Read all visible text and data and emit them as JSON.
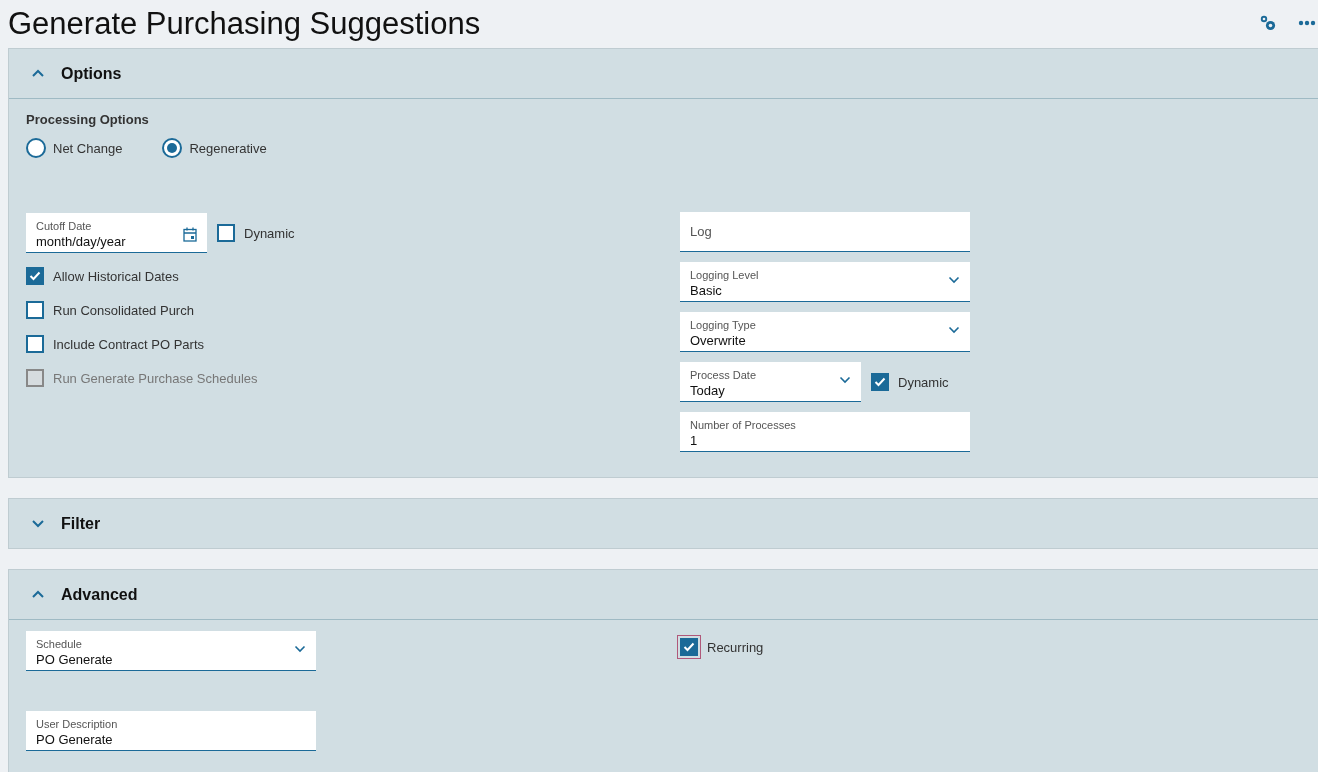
{
  "title": "Generate Purchasing Suggestions",
  "options": {
    "title": "Options",
    "expanded": true,
    "processing": {
      "label": "Processing Options",
      "radios": [
        {
          "label": "Net Change",
          "selected": false
        },
        {
          "label": "Regenerative",
          "selected": true
        }
      ]
    },
    "cutoff_date": {
      "label": "Cutoff Date",
      "value": "month/day/year"
    },
    "cutoff_dynamic": {
      "label": "Dynamic",
      "checked": false
    },
    "checkboxes": [
      {
        "label": "Allow Historical Dates",
        "checked": true,
        "disabled": false
      },
      {
        "label": "Run Consolidated Purch",
        "checked": false,
        "disabled": false
      },
      {
        "label": "Include Contract PO Parts",
        "checked": false,
        "disabled": false
      },
      {
        "label": "Run Generate Purchase Schedules",
        "checked": false,
        "disabled": true
      }
    ],
    "fields": [
      {
        "kind": "text",
        "placeholder": "Log"
      },
      {
        "kind": "select",
        "label": "Logging Level",
        "value": "Basic"
      },
      {
        "kind": "select",
        "label": "Logging Type",
        "value": "Overwrite"
      },
      {
        "kind": "select",
        "label": "Process Date",
        "value": "Today",
        "dynamic": {
          "label": "Dynamic",
          "checked": true
        }
      },
      {
        "kind": "text",
        "label": "Number of Processes",
        "value": "1"
      }
    ]
  },
  "filter": {
    "title": "Filter",
    "expanded": false
  },
  "advanced": {
    "title": "Advanced",
    "expanded": true,
    "schedule": {
      "label": "Schedule",
      "value": "PO Generate"
    },
    "recurring": {
      "label": "Recurring",
      "checked": true,
      "focused": true
    },
    "user_description": {
      "label": "User Description",
      "value": "PO Generate"
    }
  }
}
